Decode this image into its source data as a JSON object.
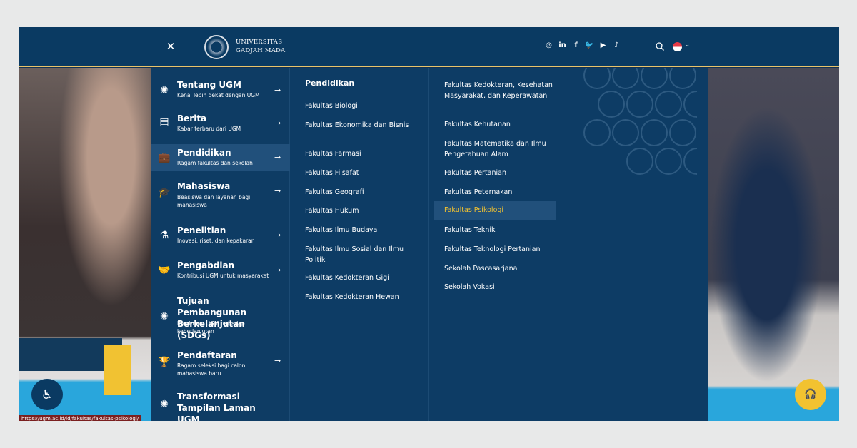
{
  "header": {
    "logo_line1": "UNIVERSITAS",
    "logo_line2": "GADJAH MADA",
    "close_glyph": "✕",
    "socials": [
      "instagram-icon",
      "linkedin-icon",
      "facebook-icon",
      "twitter-icon",
      "youtube-icon",
      "tiktok-icon"
    ],
    "social_glyphs": [
      "◎",
      "in",
      "f",
      "🐦",
      "▶",
      "♪"
    ],
    "lang_caret": "⌄"
  },
  "sidebar": {
    "items": [
      {
        "title": "Tentang UGM",
        "subtitle": "Kenal lebih dekat dengan UGM",
        "icon": "✺",
        "arrow": "→"
      },
      {
        "title": "Berita",
        "subtitle": "Kabar terbaru dari UGM",
        "icon": "▤",
        "arrow": "→"
      },
      {
        "title": "Pendidikan",
        "subtitle": "Ragam fakultas dan sekolah",
        "icon": "💼",
        "arrow": "→"
      },
      {
        "title": "Mahasiswa",
        "subtitle": "Beasiswa dan layanan bagi mahasiswa",
        "icon": "🎓",
        "arrow": "→"
      },
      {
        "title": "Penelitian",
        "subtitle": "Inovasi, riset, dan kepakaran",
        "icon": "⚗",
        "arrow": "→"
      },
      {
        "title": "Pengabdian",
        "subtitle": "Kontribusi UGM untuk masyarakat",
        "icon": "🤝",
        "arrow": "→"
      },
      {
        "title": "Tujuan Pembangunan Berkelanjutan (SDGs)",
        "subtitle": "Komitmen UGM terhadap keberlanjutan",
        "icon": "✺",
        "arrow": ""
      },
      {
        "title": "Pendaftaran",
        "subtitle": "Ragam seleksi bagi calon mahasiswa baru",
        "icon": "🏆",
        "arrow": "→"
      },
      {
        "title": "Transformasi Tampilan Laman UGM",
        "subtitle": "",
        "icon": "✺",
        "arrow": ""
      }
    ]
  },
  "col2": {
    "heading": "Pendidikan",
    "links": [
      "Fakultas Biologi",
      "Fakultas Ekonomika dan Bisnis",
      "Fakultas Farmasi",
      "Fakultas Filsafat",
      "Fakultas Geografi",
      "Fakultas Hukum",
      "Fakultas Ilmu Budaya",
      "Fakultas Ilmu Sosial dan Ilmu Politik",
      "Fakultas Kedokteran Gigi",
      "Fakultas Kedokteran Hewan"
    ]
  },
  "col3": {
    "links": [
      "Fakultas Kedokteran, Kesehatan Masyarakat, dan Keperawatan",
      "Fakultas Kehutanan",
      "Fakultas Matematika dan Ilmu Pengetahuan Alam",
      "Fakultas Pertanian",
      "Fakultas Peternakan",
      "Fakultas Psikologi",
      "Fakultas Teknik",
      "Fakultas Teknologi Pertanian",
      "Sekolah Pascasarjana",
      "Sekolah Vokasi"
    ]
  },
  "widgets": {
    "accessibility_glyph": "♿",
    "help_glyph": "🎧",
    "status_url": "https://ugm.ac.id/id/fakultas/fakultas-psikologi/"
  },
  "colors": {
    "navy": "#0a3a62",
    "accent_yellow": "#f2c230",
    "active_row": "#21507b"
  }
}
